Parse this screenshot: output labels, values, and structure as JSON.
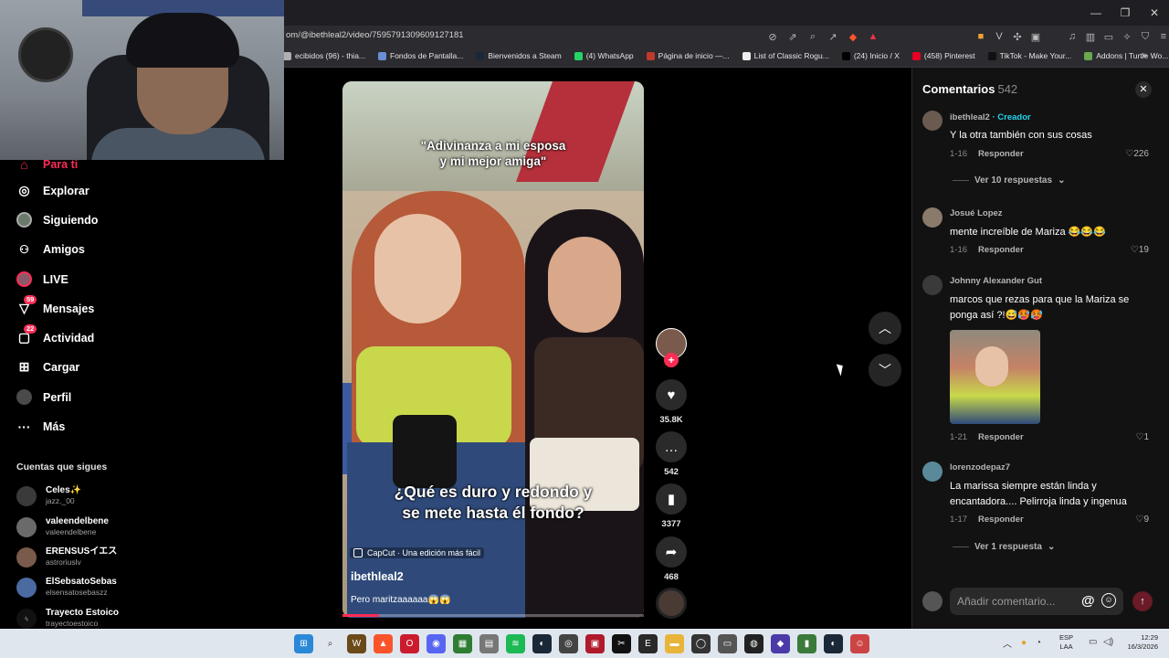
{
  "browser": {
    "url": "om/@ibethleal2/video/7595791309609127181",
    "window_controls": [
      "—",
      "❐",
      "✕"
    ],
    "bookmarks": [
      {
        "label": "ecibidos (96) - thia...",
        "color": "#b0b0b0"
      },
      {
        "label": "Fondos de Pantalla...",
        "color": "#6b8fd6"
      },
      {
        "label": "Bienvenidos a Steam",
        "color": "#1b2838"
      },
      {
        "label": "(4) WhatsApp",
        "color": "#25d366"
      },
      {
        "label": "Página de inicio —...",
        "color": "#c0392b"
      },
      {
        "label": "List of Classic Rogu...",
        "color": "#eeeeee"
      },
      {
        "label": "(24) Inicio / X",
        "color": "#000000"
      },
      {
        "label": "(458) Pinterest",
        "color": "#e60023"
      },
      {
        "label": "TikTok - Make Your...",
        "color": "#111111"
      },
      {
        "label": "Addons | Turtle Wo...",
        "color": "#6aa84f"
      }
    ]
  },
  "sidebar": {
    "items": [
      {
        "label": "Para ti",
        "icon": "home-icon",
        "glyph": "⌂"
      },
      {
        "label": "Explorar",
        "icon": "compass-icon",
        "glyph": "◎"
      },
      {
        "label": "Siguiendo",
        "icon": "following-avatar-icon",
        "glyph": "●"
      },
      {
        "label": "Amigos",
        "icon": "friends-icon",
        "glyph": "👥"
      },
      {
        "label": "LIVE",
        "icon": "live-icon",
        "glyph": "◉"
      },
      {
        "label": "Mensajes",
        "icon": "messages-icon",
        "glyph": "▽",
        "badge": "59"
      },
      {
        "label": "Actividad",
        "icon": "activity-icon",
        "glyph": "▢",
        "badge": "22"
      },
      {
        "label": "Cargar",
        "icon": "upload-icon",
        "glyph": "⊞"
      },
      {
        "label": "Perfil",
        "icon": "profile-avatar-icon",
        "glyph": "●"
      },
      {
        "label": "Más",
        "icon": "more-icon",
        "glyph": "···"
      }
    ],
    "following_title": "Cuentas que sigues",
    "accounts": [
      {
        "name": "Celes✨",
        "handle": "jazz._00"
      },
      {
        "name": "valeendelbene",
        "handle": "valeendelbene"
      },
      {
        "name": "ERENSUSイエス",
        "handle": "astroriuslv"
      },
      {
        "name": "ElSebsatoSebas",
        "handle": "elsensatosebaszz"
      },
      {
        "name": "Trayecto Estoico",
        "handle": "trayectoestoico"
      }
    ]
  },
  "video": {
    "caption_top_line1": "\"Adivinanza a mi esposa",
    "caption_top_line2": "y mi mejor amiga\"",
    "caption_bottom_line1": "¿Qué es duro y redondo y",
    "caption_bottom_line2": "se mete hasta él fondo?",
    "capcut": "CapCut · Una edición más fácil",
    "author": "ibethleal2",
    "description": "Pero maritzaaaaaa😱😱",
    "progress": 0.12
  },
  "actions": {
    "likes": "35.8K",
    "comments": "542",
    "saves": "3377",
    "shares": "468"
  },
  "comments_panel": {
    "title": "Comentarios",
    "count": "542",
    "reply_label": "Responder",
    "comments": [
      {
        "user": "ibethleal2",
        "creator_tag": "· Creador",
        "text": "Y la otra también con sus cosas",
        "date": "1-16",
        "likes": "226",
        "replies": "Ver 10 respuestas"
      },
      {
        "user": "Josué Lopez",
        "text": "mente increíble de Mariza 😂😂😂",
        "date": "1-16",
        "likes": "19"
      },
      {
        "user": "Johnny Alexander Gut",
        "text": "marcos que rezas para que la Mariza se ponga así ?!😅🥵🥵",
        "date": "1-21",
        "likes": "1"
      },
      {
        "user": "lorenzodepaz7",
        "text": "La marissa siempre están linda y encantadora.... Pelirroja linda y ingenua",
        "date": "1-17",
        "likes": "9",
        "replies": "Ver 1 respuesta"
      }
    ],
    "input_placeholder": "Añadir comentario...",
    "at_symbol": "@"
  },
  "taskbar": {
    "language_line1": "ESP",
    "language_line2": "LAA",
    "time": "12:29",
    "date": "16/3/2026",
    "apps": [
      {
        "icon": "start-icon",
        "color": "#2b88d8",
        "glyph": "⊞"
      },
      {
        "icon": "search-icon",
        "color": "#dfe6ee",
        "glyph": "⌕"
      },
      {
        "icon": "wow-icon",
        "color": "#6b4a1a",
        "glyph": "W"
      },
      {
        "icon": "brave-icon",
        "color": "#fb542b",
        "glyph": "▲"
      },
      {
        "icon": "opera-icon",
        "color": "#cc1b2f",
        "glyph": "O"
      },
      {
        "icon": "discord-icon",
        "color": "#5865f2",
        "glyph": "◉"
      },
      {
        "icon": "apps-icon",
        "color": "#2e7d32",
        "glyph": "▦"
      },
      {
        "icon": "store-icon",
        "color": "#777777",
        "glyph": "▤"
      },
      {
        "icon": "spotify-icon",
        "color": "#1db954",
        "glyph": "≋"
      },
      {
        "icon": "steam-icon",
        "color": "#1b2838",
        "glyph": "◐"
      },
      {
        "icon": "chrome-icon",
        "color": "#444444",
        "glyph": "◎"
      },
      {
        "icon": "app-red-icon",
        "color": "#b01a2a",
        "glyph": "▣"
      },
      {
        "icon": "capcut-icon",
        "color": "#111111",
        "glyph": "✂"
      },
      {
        "icon": "epic-icon",
        "color": "#2a2a2a",
        "glyph": "E"
      },
      {
        "icon": "folder-icon",
        "color": "#e8b43a",
        "glyph": "▬"
      },
      {
        "icon": "vpn-icon",
        "color": "#333333",
        "glyph": "◯"
      },
      {
        "icon": "explorer-icon",
        "color": "#555555",
        "glyph": "▭"
      },
      {
        "icon": "obs-icon",
        "color": "#222222",
        "glyph": "◍"
      },
      {
        "icon": "launcher-icon",
        "color": "#4b3aa8",
        "glyph": "◆"
      },
      {
        "icon": "notepad-icon",
        "color": "#3a7a3a",
        "glyph": "▮"
      },
      {
        "icon": "steam2-icon",
        "color": "#1b2838",
        "glyph": "◐"
      },
      {
        "icon": "game-icon",
        "color": "#c44",
        "glyph": "☺"
      }
    ]
  }
}
